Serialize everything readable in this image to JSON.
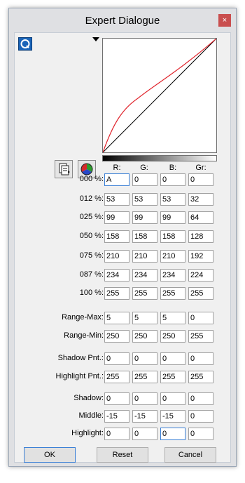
{
  "window": {
    "title": "Expert Dialogue",
    "close_glyph": "×"
  },
  "icons": {
    "help": "help-q-icon",
    "dropdown": "triangle-down-icon",
    "copy": "copy-page-icon",
    "color_wheel": "rgb-color-wheel-icon"
  },
  "columns": [
    "R:",
    "G:",
    "B:",
    "Gr:"
  ],
  "rows": [
    {
      "label": "000 %:",
      "values": [
        "A",
        "0",
        "0",
        "0"
      ]
    },
    {
      "label": "012 %:",
      "values": [
        "53",
        "53",
        "53",
        "32"
      ]
    },
    {
      "label": "025 %:",
      "values": [
        "99",
        "99",
        "99",
        "64"
      ]
    },
    {
      "label": "050 %:",
      "values": [
        "158",
        "158",
        "158",
        "128"
      ]
    },
    {
      "label": "075 %:",
      "values": [
        "210",
        "210",
        "210",
        "192"
      ]
    },
    {
      "label": "087 %:",
      "values": [
        "234",
        "234",
        "234",
        "224"
      ]
    },
    {
      "label": "100 %:",
      "values": [
        "255",
        "255",
        "255",
        "255"
      ]
    },
    {
      "label": "Range-Max:",
      "values": [
        "5",
        "5",
        "5",
        "0"
      ]
    },
    {
      "label": "Range-Min:",
      "values": [
        "250",
        "250",
        "250",
        "255"
      ]
    },
    {
      "label": "Shadow Pnt.:",
      "values": [
        "0",
        "0",
        "0",
        "0"
      ]
    },
    {
      "label": "Highlight Pnt.:",
      "values": [
        "255",
        "255",
        "255",
        "255"
      ]
    },
    {
      "label": "Shadow:",
      "values": [
        "0",
        "0",
        "0",
        "0"
      ]
    },
    {
      "label": "Middle:",
      "values": [
        "-15",
        "-15",
        "-15",
        "0"
      ]
    },
    {
      "label": "Highlight:",
      "values": [
        "0",
        "0",
        "0",
        "0"
      ]
    }
  ],
  "buttons": {
    "ok": "OK",
    "reset": "Reset",
    "cancel": "Cancel"
  },
  "colors": {
    "curve_red": "#e0242c",
    "curve_black": "#000000",
    "close_bg": "#c94f4f",
    "focus_blue": "#3a7fd5"
  }
}
